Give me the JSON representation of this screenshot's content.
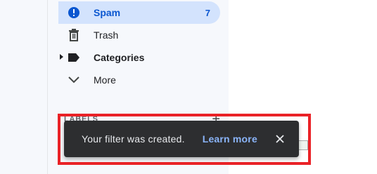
{
  "sidebar": {
    "items": [
      {
        "label": "Spam",
        "count": "7",
        "icon": "spam-icon",
        "active": true
      },
      {
        "label": "Trash",
        "icon": "trash-icon"
      },
      {
        "label": "Categories",
        "icon": "label-icon"
      },
      {
        "label": "More",
        "icon": "chevron-down-icon"
      }
    ],
    "labels_header": "LABELS",
    "labels_add": "+"
  },
  "snackbar": {
    "message": "Your filter was created.",
    "link": "Learn more",
    "close_icon": "close-icon"
  },
  "colors": {
    "active_bg": "#d3e3fd",
    "active_text": "#0b57d0",
    "snackbar_bg": "#2d2e30",
    "link": "#8ab4f8",
    "highlight": "#ea2227"
  }
}
